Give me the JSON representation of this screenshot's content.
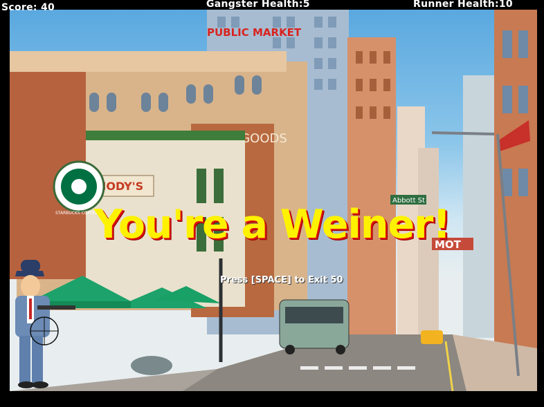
{
  "hud": {
    "score_text": "Score: 40",
    "gangster_health_text": "Gangster Health:5",
    "runner_health_text": "Runner Health:10"
  },
  "overlay": {
    "result_message": "You're a Weiner!",
    "exit_prompt": "Press [SPACE] to Exit  50"
  },
  "scene": {
    "signs": {
      "public_market": "PUBLIC MARKET",
      "fine_goods": "FINE GOODS",
      "nodys": "NODY'S",
      "starbucks": "STARBUCKS COFFEE",
      "abbott_st": "Abbott St",
      "motel": "MOT"
    }
  },
  "colors": {
    "message": "#fff200",
    "message_shadow": "#d11111",
    "sky": "#5aa8df"
  }
}
